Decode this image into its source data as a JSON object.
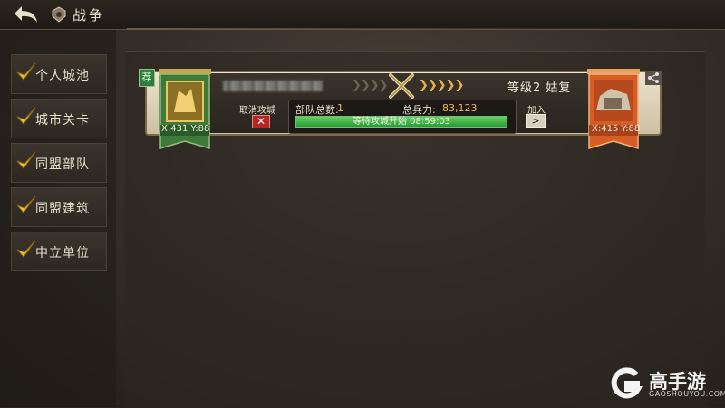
{
  "header": {
    "title": "战争"
  },
  "sidebar": {
    "items": [
      {
        "label": "个人城池"
      },
      {
        "label": "城市关卡"
      },
      {
        "label": "同盟部队"
      },
      {
        "label": "同盟建筑"
      },
      {
        "label": "中立单位"
      }
    ]
  },
  "battle": {
    "recommend_badge": "荐",
    "left_coord": "X:431 Y:88",
    "right_coord": "X:415 Y:88",
    "target_level": "等级2 姑复",
    "cancel_label": "取消攻城",
    "cancel_button": "✕",
    "troops_label": "部队总数:",
    "troops_value": "1",
    "power_label": "总兵力:",
    "power_value": "83,123",
    "progress_text": "等待攻城开始 08:59:03",
    "progress_fraction": 1.0,
    "join_label": "加入",
    "join_button": ">"
  },
  "watermark": {
    "brand": "高手游",
    "site": "GAOSHOUYOU.COM"
  },
  "colors": {
    "accent_green": "#2c9a35",
    "accent_orange": "#e8b24a",
    "cancel_red": "#b82424"
  }
}
